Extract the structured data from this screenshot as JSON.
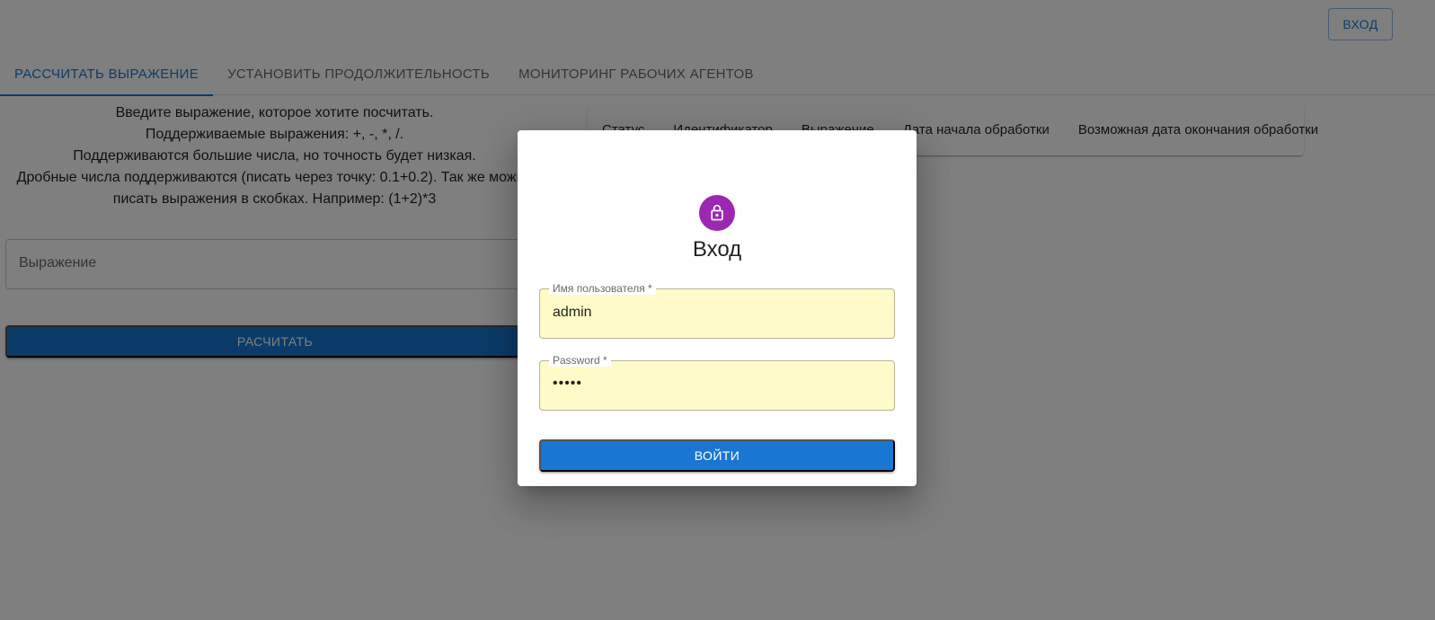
{
  "header": {
    "login_label": "ВХОД"
  },
  "tabs": [
    {
      "label": "РАССЧИТАТЬ ВЫРАЖЕНИЕ",
      "active": true
    },
    {
      "label": "УСТАНОВИТЬ ПРОДОЛЖИТЕЛЬНОСТЬ",
      "active": false
    },
    {
      "label": "МОНИТОРИНГ РАБОЧИХ АГЕНТОВ",
      "active": false
    }
  ],
  "calculator": {
    "instructions": [
      "Введите выражение, которое хотите посчитать.",
      "Поддерживаемые выражения: +, -, *, /.",
      "Поддерживаются большие числа, но точность будет низкая.",
      "Дробные числа поддерживаются (писать через точку: 0.1+0.2). Так же можно",
      "писать выражения в скобках. Например: (1+2)*3"
    ],
    "expression_placeholder": "Выражение",
    "calculate_label": "РАСЧИТАТЬ"
  },
  "table": {
    "headers": [
      "Статус",
      "Идентификатор",
      "Выражение",
      "Дата начала обработки",
      "Возможная дата окончания обработки"
    ]
  },
  "login_dialog": {
    "icon": "lock-icon",
    "title": "Вход",
    "username_label": "Имя пользователя *",
    "username_value": "admin",
    "password_label": "Password *",
    "password_masked": "•••••",
    "submit_label": "ВОЙТИ"
  },
  "colors": {
    "primary": "#1976d2",
    "avatar": "#9c27b0",
    "autofill": "#fffbc8"
  }
}
